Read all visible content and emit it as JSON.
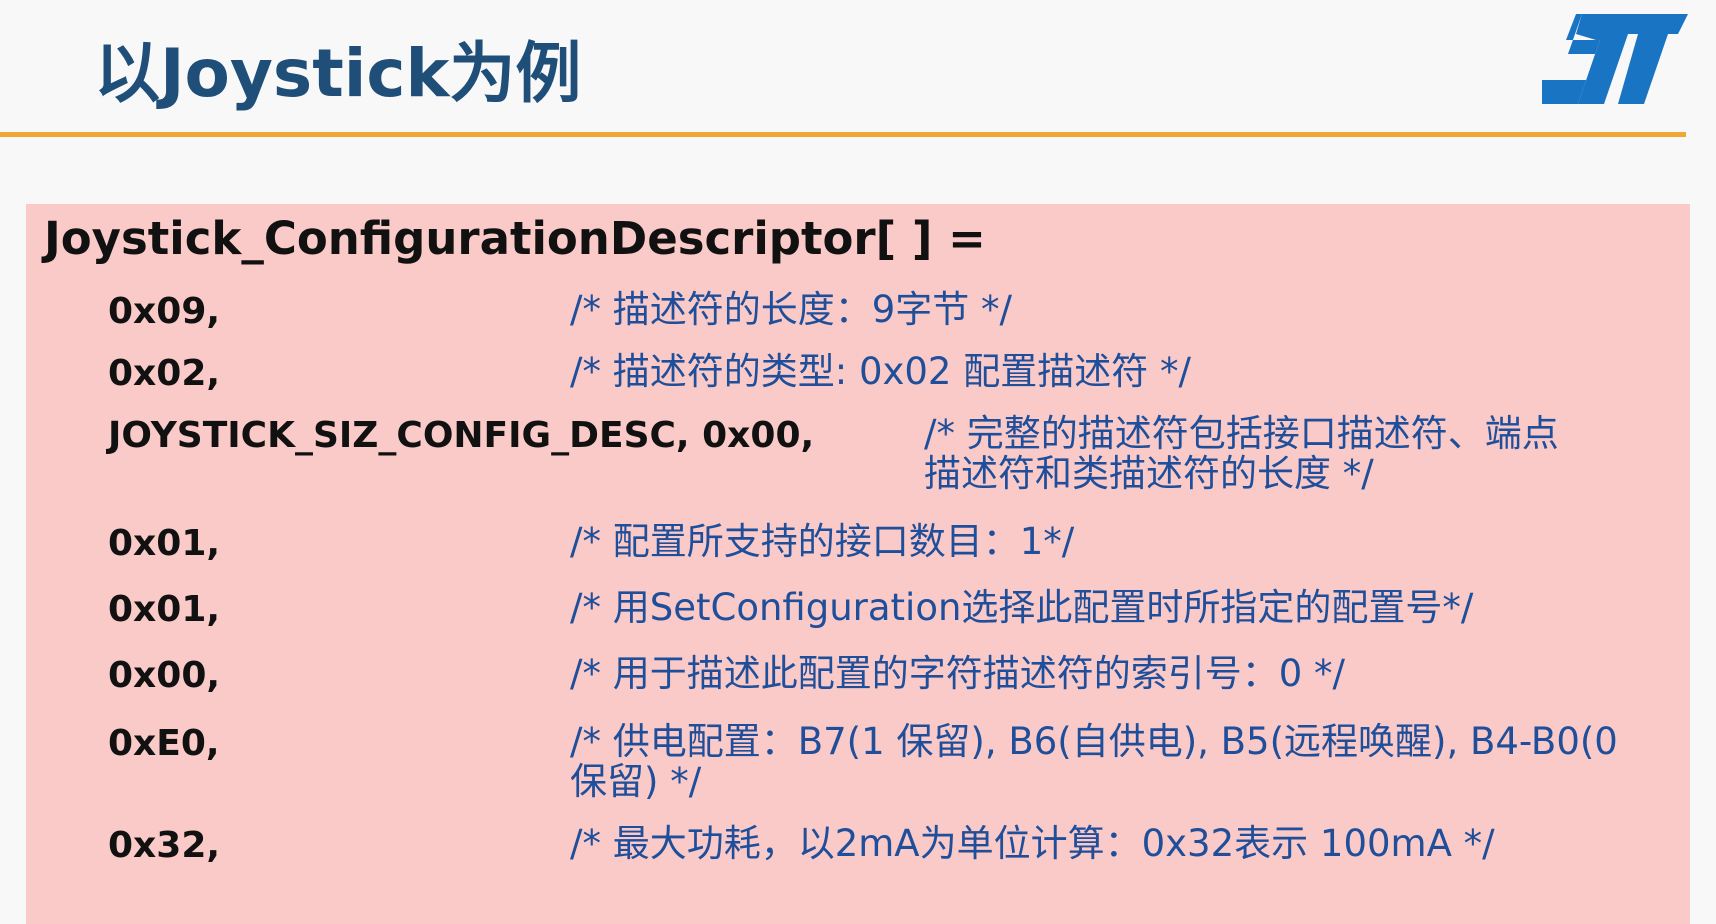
{
  "slide": {
    "title": "以Joystick为例",
    "logo": "st-logo"
  },
  "descriptor": {
    "name": "Joystick_ConfigurationDescriptor[ ] =",
    "rows": [
      {
        "code": "0x09,",
        "comment": "/* 描述符的长度：9字节 */"
      },
      {
        "code": "0x02,",
        "comment": "/* 描述符的类型: 0x02 配置描述符 */"
      },
      {
        "code": "JOYSTICK_SIZ_CONFIG_DESC, 0x00,",
        "comment": "/* 完整的描述符包括接口描述符、端点描述符和类描述符的长度 */"
      },
      {
        "code": "0x01,",
        "comment": "/* 配置所支持的接口数目：1*/"
      },
      {
        "code": "0x01,",
        "comment": "/* 用SetConfiguration选择此配置时所指定的配置号*/"
      },
      {
        "code": "0x00,",
        "comment": "/* 用于描述此配置的字符描述符的索引号：0 */"
      },
      {
        "code": "0xE0,",
        "comment": "/* 供电配置：B7(1 保留), B6(自供电), B5(远程唤醒), B4-B0(0 保留) */"
      },
      {
        "code": "0x32,",
        "comment": "/* 最大功耗，以2mA为单位计算：0x32表示 100mA */"
      }
    ]
  },
  "colors": {
    "title": "#1f4e79",
    "accent_line": "#f0a733",
    "panel_bg": "#f9cac7",
    "comment": "#1f4e9a",
    "logo": "#1a74c4"
  }
}
